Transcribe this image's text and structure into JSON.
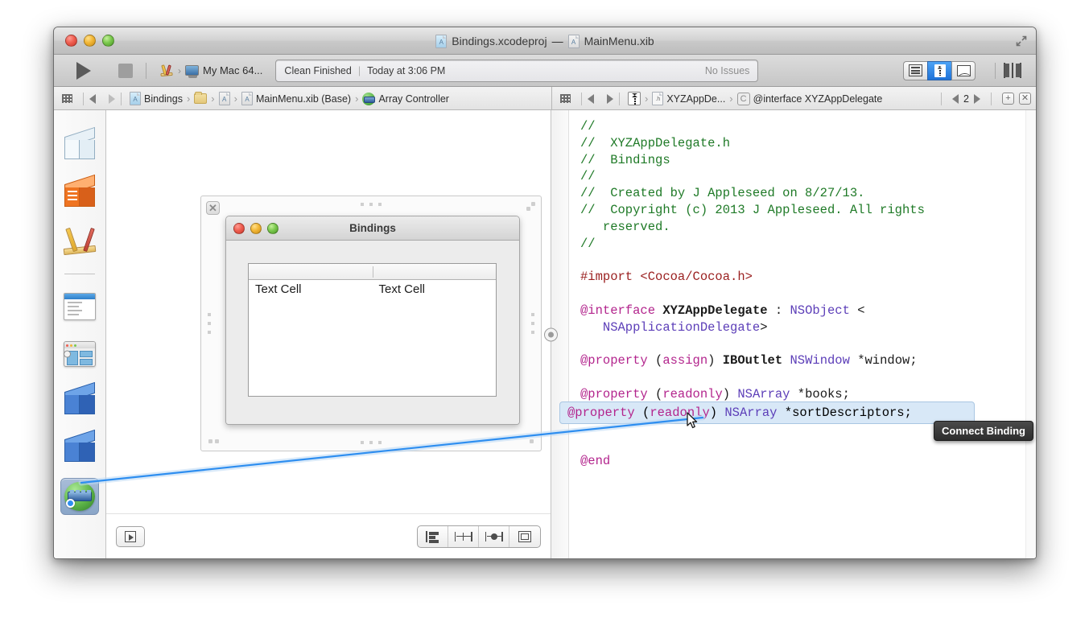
{
  "window": {
    "title_project": "Bindings.xcodeproj",
    "title_dash": "—",
    "title_file": "MainMenu.xib",
    "traffic": [
      "close",
      "minimize",
      "zoom"
    ]
  },
  "toolbar": {
    "run_label": "Run",
    "stop_label": "Stop",
    "scheme_app": "Xcode",
    "scheme_chevron": "›",
    "scheme_destination": "My Mac 64...",
    "status_primary": "Clean Finished",
    "status_separator": "|",
    "status_time": "Today at 3:06 PM",
    "status_issues": "No Issues",
    "editor_buttons": [
      "standard-editor",
      "assistant-editor",
      "version-editor"
    ],
    "editor_selected": "assistant-editor",
    "view_buttons": [
      "navigator-toggle",
      "debug-toggle",
      "utilities-toggle"
    ]
  },
  "jumpbar_left": {
    "grid_icon": "related-items-icon",
    "back_label": "Back",
    "forward_label": "Forward",
    "crumbs": [
      {
        "label": "Bindings",
        "icon": "xcodeproj-icon"
      },
      {
        "label": "",
        "icon": "folder-icon"
      },
      {
        "label": "",
        "icon": "xib-icon"
      },
      {
        "label": "MainMenu.xib (Base)",
        "icon": "xib-icon"
      },
      {
        "label": "Array Controller",
        "icon": "array-controller-icon"
      }
    ],
    "separator": "›"
  },
  "jumpbar_right": {
    "grid_icon": "related-items-icon",
    "back_label": "Back",
    "forward_label": "Forward",
    "crumbs": [
      {
        "label": "",
        "icon": "tuxedo-icon"
      },
      {
        "label": "XYZAppDe...",
        "icon": "header-file-icon"
      },
      {
        "label": "@interface XYZAppDelegate",
        "icon": "class-c-icon"
      }
    ],
    "separator": "›",
    "counter": "2",
    "prev_label": "Previous",
    "next_label": "Next",
    "add_label": "+",
    "close_label": "✕"
  },
  "dock": {
    "items": [
      {
        "name": "placeholder-cube-icon",
        "label": "Placeholders"
      },
      {
        "name": "files-owner-icon",
        "label": "File's Owner"
      },
      {
        "name": "first-responder-icon",
        "label": "First Responder"
      },
      {
        "name": "main-menu-icon",
        "label": "Main Menu"
      },
      {
        "name": "window-icon",
        "label": "Window"
      },
      {
        "name": "object-cube-1-icon",
        "label": "Object"
      },
      {
        "name": "object-cube-2-icon",
        "label": "Object"
      },
      {
        "name": "array-controller-icon",
        "label": "Array Controller"
      }
    ],
    "selected_index": 7
  },
  "canvas": {
    "ib_window": {
      "title": "Bindings",
      "table": {
        "columns": [
          "",
          ""
        ],
        "rows": [
          [
            "Text Cell",
            "Text Cell"
          ]
        ]
      }
    },
    "close_glyph": "✕"
  },
  "canvas_bottom": {
    "outline_button_label": "Document Outline",
    "layout_buttons": [
      {
        "name": "align-button",
        "label": "Align"
      },
      {
        "name": "pin-button",
        "label": "Pin"
      },
      {
        "name": "resolve-issues-button",
        "label": "Resolve Auto Layout Issues"
      },
      {
        "name": "resizing-behavior-button",
        "label": "Resizing Behavior"
      }
    ]
  },
  "editor": {
    "filename": "XYZAppDelegate.h",
    "code_lines": [
      {
        "text": "//",
        "type": "comment"
      },
      {
        "text": "//  XYZAppDelegate.h",
        "type": "comment"
      },
      {
        "text": "//  Bindings",
        "type": "comment"
      },
      {
        "text": "//",
        "type": "comment"
      },
      {
        "text": "//  Created by J Appleseed on 8/27/13.",
        "type": "comment"
      },
      {
        "text": "//  Copyright (c) 2013 J Appleseed. All rights reserved.",
        "type": "comment"
      },
      {
        "text": "//",
        "type": "comment"
      },
      {
        "text": "",
        "type": "blank"
      },
      {
        "text": "#import <Cocoa/Cocoa.h>",
        "type": "preprocessor"
      },
      {
        "text": "",
        "type": "blank"
      },
      {
        "text": "@interface XYZAppDelegate : NSObject <NSApplicationDelegate>",
        "type": "code"
      },
      {
        "text": "",
        "type": "blank"
      },
      {
        "text": "@property (assign) IBOutlet NSWindow *window;",
        "type": "code"
      },
      {
        "text": "",
        "type": "blank"
      },
      {
        "text": "@property (readonly) NSArray *books;",
        "type": "code"
      },
      {
        "text": "",
        "type": "blank"
      },
      {
        "text": "@property (readonly) NSArray *sortDescriptors;",
        "type": "code",
        "highlighted": true
      },
      {
        "text": "",
        "type": "blank"
      },
      {
        "text": "@end",
        "type": "code"
      }
    ]
  },
  "tooltip": {
    "text": "Connect Binding"
  },
  "colors": {
    "accent_blue": "#2e8ef0",
    "comment_green": "#1f7a27",
    "preprocessor_red": "#9a1f1f",
    "keyword_magenta": "#b3258d",
    "class_purple": "#5c3eb8",
    "highlight_fill": "#d8e8f7",
    "highlight_border": "#a9c6e2"
  }
}
